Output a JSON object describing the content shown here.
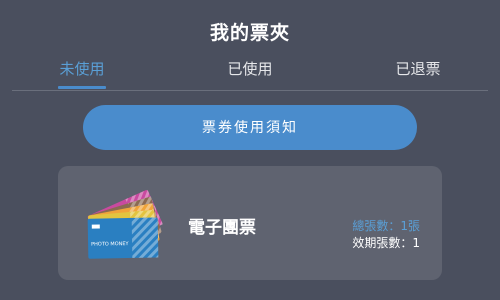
{
  "header": {
    "title": "我的票夾"
  },
  "tabs": [
    {
      "label": "未使用",
      "active": true
    },
    {
      "label": "已使用",
      "active": false
    },
    {
      "label": "已退票",
      "active": false
    }
  ],
  "notice_button": {
    "label": "票券使用須知"
  },
  "ticket_card": {
    "name": "電子團票",
    "total_count": "總張數：1張",
    "valid_count": "效期張數：1",
    "image_text": "PHOTO MONEY"
  },
  "colors": {
    "background": "#4a4f5e",
    "accent": "#4a8ccc",
    "card": "#5f6370"
  },
  "icons": {
    "ticket_image": "ticket-stack-icon"
  }
}
